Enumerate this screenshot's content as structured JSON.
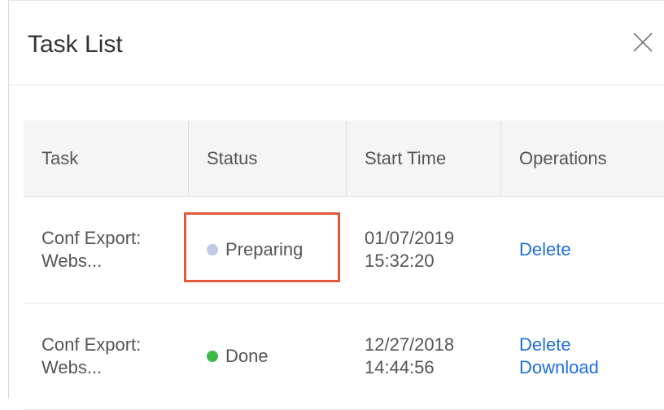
{
  "dialog": {
    "title": "Task List",
    "close_icon": "close-icon"
  },
  "table": {
    "columns": [
      "Task",
      "Status",
      "Start Time",
      "Operations"
    ],
    "rows": [
      {
        "task_line1": "Conf Export:",
        "task_line2": "Webs...",
        "status": "Preparing",
        "status_color": "#c3c9e8",
        "date": "01/07/2019",
        "time": "15:32:20",
        "ops": [
          "Delete"
        ]
      },
      {
        "task_line1": "Conf Export:",
        "task_line2": "Webs...",
        "status": "Done",
        "status_color": "#3dbb4a",
        "date": "12/27/2018",
        "time": "14:44:56",
        "ops": [
          "Delete",
          "Download"
        ]
      }
    ]
  },
  "colors": {
    "link": "#1e6fe0",
    "highlight": "#e05a3a"
  }
}
